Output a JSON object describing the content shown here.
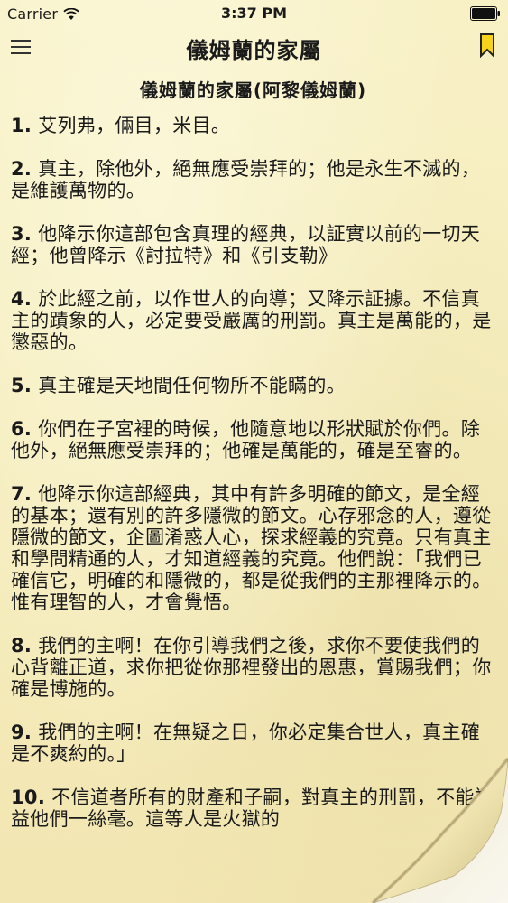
{
  "status_bar": {
    "carrier": "Carrier",
    "time": "3:37 PM"
  },
  "nav": {
    "title": "儀姆蘭的家屬"
  },
  "chapter": {
    "heading": "儀姆蘭的家屬(阿黎儀姆蘭)"
  },
  "verses": [
    {
      "num": "1.",
      "text": "艾列弗，倆目，米目。"
    },
    {
      "num": "2.",
      "text": "真主，除他外，絕無應受崇拜的；他是永生不滅的，是維護萬物的。"
    },
    {
      "num": "3.",
      "text": "他降示你這部包含真理的經典，以証實以前的一切天經；他曾降示《討拉特》和《引支勒》"
    },
    {
      "num": "4.",
      "text": "於此經之前，以作世人的向導；又降示証據。不信真主的蹟象的人，必定要受嚴厲的刑罰。真主是萬能的，是懲惡的。"
    },
    {
      "num": "5.",
      "text": "真主確是天地間任何物所不能瞞的。"
    },
    {
      "num": "6.",
      "text": "你們在子宮裡的時候，他隨意地以形狀賦於你們。除他外，絕無應受崇拜的；他確是萬能的，確是至睿的。"
    },
    {
      "num": "7.",
      "text": "他降示你這部經典，其中有許多明確的節文，是全經的基本；還有別的許多隱微的節文。心存邪念的人，遵從隱微的節文，企圖淆惑人心，探求經義的究竟。只有真主和學問精通的人，才知道經義的究竟。他們說：「我們已確信它，明確的和隱微的，都是從我們的主那裡降示的。惟有理智的人，才會覺悟。"
    },
    {
      "num": "8.",
      "text": "我們的主啊！在你引導我們之後，求你不要使我們的心背離正道，求你把從你那裡發出的恩惠，賞賜我們；你確是博施的。"
    },
    {
      "num": "9.",
      "text": "我們的主啊！在無疑之日，你必定集合世人，真主確是不爽約的。」"
    },
    {
      "num": "10.",
      "text": "不信道者所有的財產和子嗣，對真主的刑罰，不能裨益他們一絲毫。這等人是火獄的"
    }
  ]
}
